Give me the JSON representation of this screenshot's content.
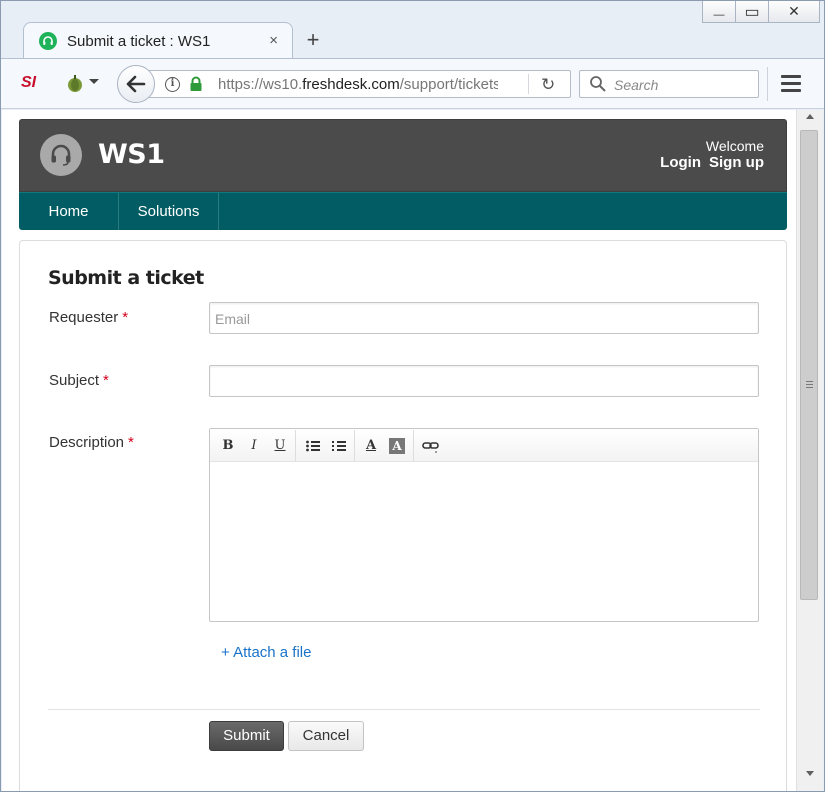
{
  "browser": {
    "tab_title": "Submit a ticket : WS1",
    "tab_close": "×",
    "new_tab": "+",
    "url_prefix": "https://ws10.",
    "url_domain": "freshdesk.com",
    "url_suffix": "/support/tickets",
    "search_placeholder": "Search",
    "window_controls": {
      "minimize": "—",
      "restore": "▭",
      "close": "✕"
    },
    "extension_si": "SI"
  },
  "portal": {
    "brand": "WS1",
    "welcome": "Welcome",
    "login": "Login",
    "signup": "Sign up",
    "nav": [
      {
        "label": "Home"
      },
      {
        "label": "Solutions"
      }
    ],
    "header_bg": "#4c4b4b",
    "nav_bg": "#015d63"
  },
  "form": {
    "title": "Submit a ticket",
    "requester_label": "Requester",
    "requester_placeholder": "Email",
    "subject_label": "Subject",
    "description_label": "Description",
    "required_mark": "*",
    "toolbar": [
      "bold",
      "italic",
      "underline",
      "bulleted-list",
      "numbered-list",
      "font-color",
      "background-color",
      "link"
    ],
    "toolbar_glyphs": {
      "bold": "B",
      "italic": "I",
      "underline": "U",
      "font_color": "A",
      "background_color": "A"
    },
    "attach_label": "+ Attach a file",
    "submit_label": "Submit",
    "cancel_label": "Cancel"
  }
}
